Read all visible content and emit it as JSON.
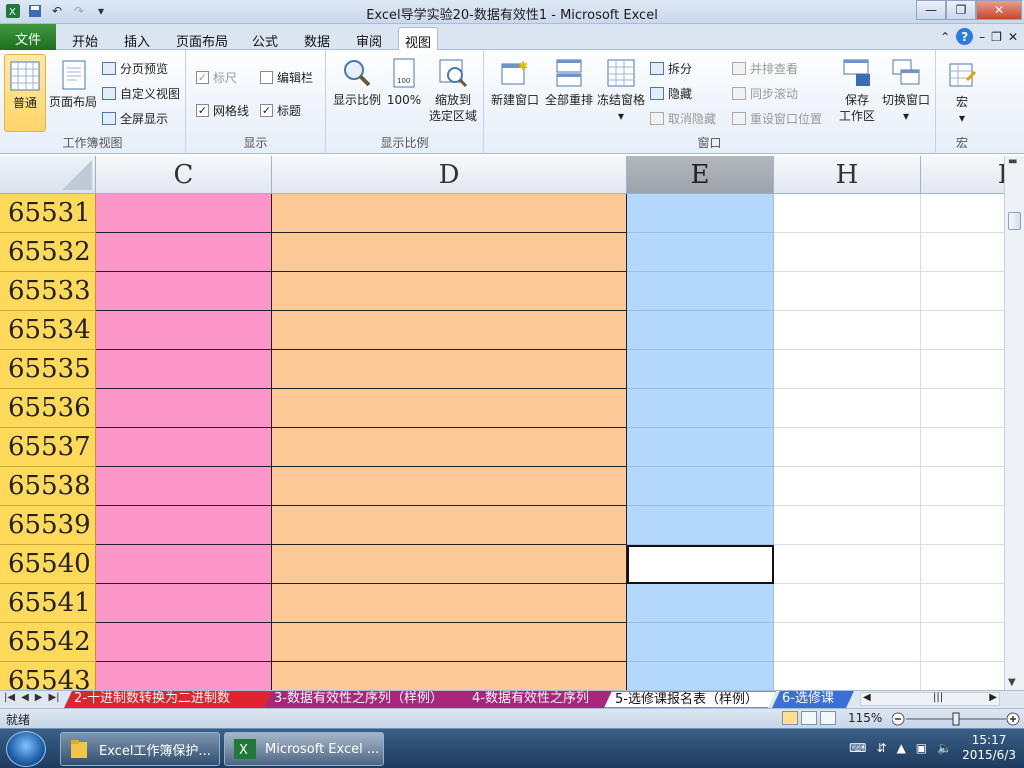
{
  "window": {
    "title": "Excel导学实验20-数据有效性1  -  Microsoft Excel",
    "controls": {
      "minimize": "▭",
      "restore": "❐",
      "close": "✕"
    }
  },
  "quick_access": [
    "save-icon",
    "undo-icon",
    "redo-icon",
    "customize-icon"
  ],
  "tabs": {
    "file": "文件",
    "items": [
      "开始",
      "插入",
      "页面布局",
      "公式",
      "数据",
      "审阅",
      "视图"
    ],
    "active": "视图"
  },
  "ribbon": {
    "workbook_views": {
      "label": "工作簿视图",
      "normal": "普通",
      "page_layout": "页面布局",
      "page_break_preview": "分页预览",
      "custom_views": "自定义视图",
      "full_screen": "全屏显示"
    },
    "show": {
      "label": "显示",
      "ruler": "标尺",
      "formula_bar": "编辑栏",
      "gridlines": "网格线",
      "headings": "标题",
      "ruler_checked": true,
      "formula_bar_checked": false,
      "gridlines_checked": true,
      "headings_checked": true
    },
    "zoom": {
      "label": "显示比例",
      "zoom": "显示比例",
      "hundred": "100%",
      "to_selection_line1": "缩放到",
      "to_selection_line2": "选定区域"
    },
    "window": {
      "label": "窗口",
      "new_window": "新建窗口",
      "arrange_all": "全部重排",
      "freeze_panes": "冻结窗格",
      "split": "拆分",
      "hide": "隐藏",
      "unhide": "取消隐藏",
      "side_by_side": "并排查看",
      "sync_scroll": "同步滚动",
      "reset_position": "重设窗口位置",
      "save_workspace_line1": "保存",
      "save_workspace_line2": "工作区",
      "switch_windows": "切换窗口"
    },
    "macros": {
      "label": "宏",
      "macros": "宏"
    }
  },
  "grid": {
    "columns": [
      {
        "key": "C",
        "label": "C"
      },
      {
        "key": "D",
        "label": "D"
      },
      {
        "key": "E",
        "label": "E",
        "selected": true
      },
      {
        "key": "H",
        "label": "H"
      },
      {
        "key": "I",
        "label": "I"
      }
    ],
    "rows": [
      "65531",
      "65532",
      "65533",
      "65534",
      "65535",
      "65536",
      "65537",
      "65538",
      "65539",
      "65540",
      "65541",
      "65542",
      "65543"
    ],
    "active_cell": {
      "row": "65540",
      "column": "E"
    },
    "colors": {
      "C": "#fd96c9",
      "D": "#fdc998",
      "E": "#b4d8fb",
      "row_header": "#ffd95a"
    }
  },
  "sheet_tabs": [
    {
      "label": "2-十进制数转换为二进制数",
      "color": "#e0242f",
      "text_color": "#ffffff"
    },
    {
      "label": "3-数据有效性之序列（样例）",
      "color": "#a8267c",
      "text_color": "#ffffff"
    },
    {
      "label": "4-数据有效性之序列",
      "color": "#a8267c",
      "text_color": "#ffffff"
    },
    {
      "label": "5-选修课报名表（样例）",
      "color": "#ffffff",
      "text_color": "#111111",
      "active": true
    },
    {
      "label": "6-选修课",
      "color": "#3b6fd8",
      "text_color": "#ffffff"
    }
  ],
  "status": {
    "ready": "就绪",
    "zoom": "115%",
    "zoom_fraction": 0.5
  },
  "taskbar": {
    "items": [
      {
        "label": "Excel工作簿保护...",
        "icon": "folder-icon"
      },
      {
        "label": "Microsoft Excel ...",
        "icon": "excel-icon",
        "active": true
      }
    ],
    "time": "15:17",
    "date": "2015/6/3"
  }
}
